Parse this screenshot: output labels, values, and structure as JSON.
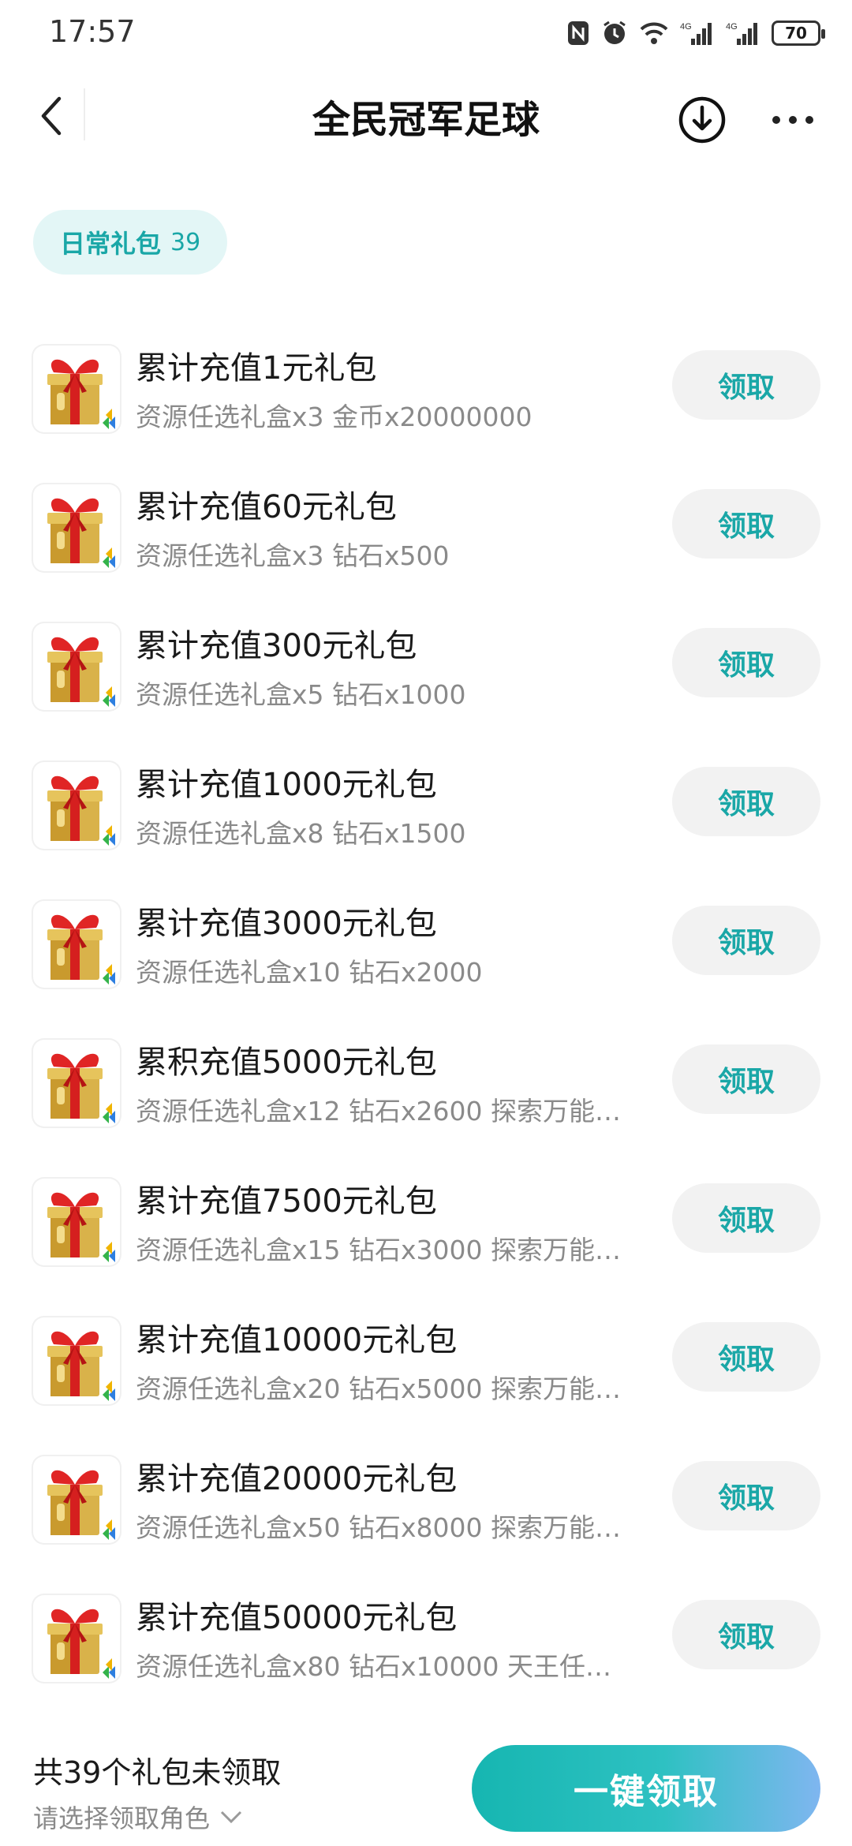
{
  "status_bar": {
    "time": "17:57",
    "battery": "70",
    "icons": [
      "nfc-icon",
      "alarm-icon",
      "wifi-icon",
      "signal-4g-icon",
      "signal-4g-icon",
      "battery-icon"
    ]
  },
  "header": {
    "title": "全民冠军足球",
    "icons": [
      "back-icon",
      "download-icon",
      "more-icon"
    ]
  },
  "tag": {
    "label": "日常礼包",
    "count": "39"
  },
  "gifts": [
    {
      "title": "累计充值1元礼包",
      "desc": "资源任选礼盒x3 金币x20000000",
      "button": "领取"
    },
    {
      "title": "累计充值60元礼包",
      "desc": "资源任选礼盒x3 钻石x500",
      "button": "领取"
    },
    {
      "title": "累计充值300元礼包",
      "desc": "资源任选礼盒x5 钻石x1000",
      "button": "领取"
    },
    {
      "title": "累计充值1000元礼包",
      "desc": "资源任选礼盒x8 钻石x1500",
      "button": "领取"
    },
    {
      "title": "累计充值3000元礼包",
      "desc": "资源任选礼盒x10 钻石x2000",
      "button": "领取"
    },
    {
      "title": "累积充值5000元礼包",
      "desc": "资源任选礼盒x12 钻石x2600 探索万能…",
      "button": "领取"
    },
    {
      "title": "累计充值7500元礼包",
      "desc": "资源任选礼盒x15 钻石x3000 探索万能…",
      "button": "领取"
    },
    {
      "title": "累计充值10000元礼包",
      "desc": "资源任选礼盒x20 钻石x5000 探索万能…",
      "button": "领取"
    },
    {
      "title": "累计充值20000元礼包",
      "desc": "资源任选礼盒x50 钻石x8000 探索万能…",
      "button": "领取"
    },
    {
      "title": "累计充值50000元礼包",
      "desc": "资源任选礼盒x80 钻石x10000 天王任…",
      "button": "领取"
    }
  ],
  "bottom": {
    "summary": "共39个礼包未领取",
    "role_select": "请选择领取角色",
    "claim_all": "一键领取"
  },
  "colors": {
    "accent": "#1aa7a7",
    "chip_bg": "#e3f6f6",
    "button_bg": "#f2f2f2"
  }
}
